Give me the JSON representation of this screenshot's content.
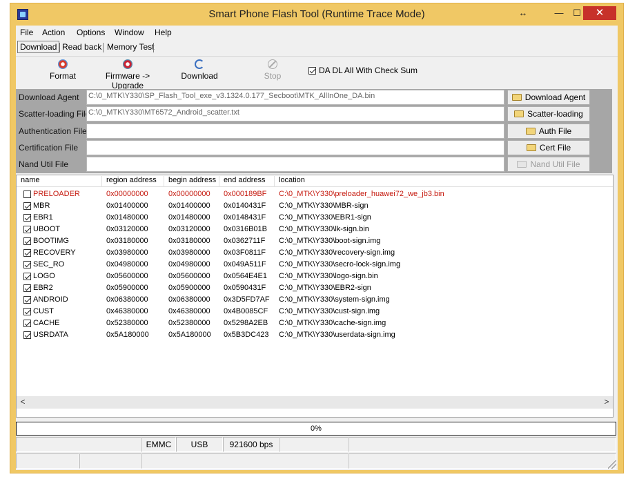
{
  "window": {
    "title": "Smart Phone Flash Tool (Runtime Trace Mode)",
    "resize_glyph": "↔",
    "min_glyph": "—",
    "max_glyph": "☐",
    "close_glyph": "✕"
  },
  "menu": [
    "File",
    "Action",
    "Options",
    "Window",
    "Help"
  ],
  "tabs": [
    "Download",
    "Read back",
    "Memory Test"
  ],
  "toolbar": {
    "format": "Format",
    "firmware_upgrade": "Firmware -> Upgrade",
    "download": "Download",
    "stop": "Stop",
    "checksum_label": "DA DL All With Check Sum",
    "checksum_checked": true
  },
  "files": [
    {
      "label": "Download Agent",
      "value": "C:\\0_MTK\\Y330\\SP_Flash_Tool_exe_v3.1324.0.177_Secboot\\MTK_AllInOne_DA.bin",
      "button": "Download Agent",
      "enabled": true
    },
    {
      "label": "Scatter-loading File",
      "value": "C:\\0_MTK\\Y330\\MT6572_Android_scatter.txt",
      "button": "Scatter-loading",
      "enabled": true
    },
    {
      "label": "Authentication File",
      "value": "",
      "button": "Auth File",
      "enabled": true
    },
    {
      "label": "Certification File",
      "value": "",
      "button": "Cert File",
      "enabled": true
    },
    {
      "label": "Nand Util File",
      "value": "",
      "button": "Nand Util File",
      "enabled": false
    }
  ],
  "list": {
    "columns": [
      "name",
      "region address",
      "begin address",
      "end address",
      "location"
    ],
    "rows": [
      {
        "checked": false,
        "name": "PRELOADER",
        "region": "0x00000000",
        "begin": "0x00000000",
        "end": "0x000189BF",
        "location": "C:\\0_MTK\\Y330\\preloader_huawei72_we_jb3.bin",
        "warn": true
      },
      {
        "checked": true,
        "name": "MBR",
        "region": "0x01400000",
        "begin": "0x01400000",
        "end": "0x0140431F",
        "location": "C:\\0_MTK\\Y330\\MBR-sign"
      },
      {
        "checked": true,
        "name": "EBR1",
        "region": "0x01480000",
        "begin": "0x01480000",
        "end": "0x0148431F",
        "location": "C:\\0_MTK\\Y330\\EBR1-sign"
      },
      {
        "checked": true,
        "name": "UBOOT",
        "region": "0x03120000",
        "begin": "0x03120000",
        "end": "0x0316B01B",
        "location": "C:\\0_MTK\\Y330\\lk-sign.bin"
      },
      {
        "checked": true,
        "name": "BOOTIMG",
        "region": "0x03180000",
        "begin": "0x03180000",
        "end": "0x0362711F",
        "location": "C:\\0_MTK\\Y330\\boot-sign.img"
      },
      {
        "checked": true,
        "name": "RECOVERY",
        "region": "0x03980000",
        "begin": "0x03980000",
        "end": "0x03F0811F",
        "location": "C:\\0_MTK\\Y330\\recovery-sign.img"
      },
      {
        "checked": true,
        "name": "SEC_RO",
        "region": "0x04980000",
        "begin": "0x04980000",
        "end": "0x049A511F",
        "location": "C:\\0_MTK\\Y330\\secro-lock-sign.img"
      },
      {
        "checked": true,
        "name": "LOGO",
        "region": "0x05600000",
        "begin": "0x05600000",
        "end": "0x0564E4E1",
        "location": "C:\\0_MTK\\Y330\\logo-sign.bin"
      },
      {
        "checked": true,
        "name": "EBR2",
        "region": "0x05900000",
        "begin": "0x05900000",
        "end": "0x0590431F",
        "location": "C:\\0_MTK\\Y330\\EBR2-sign"
      },
      {
        "checked": true,
        "name": "ANDROID",
        "region": "0x06380000",
        "begin": "0x06380000",
        "end": "0x3D5FD7AF",
        "location": "C:\\0_MTK\\Y330\\system-sign.img"
      },
      {
        "checked": true,
        "name": "CUST",
        "region": "0x46380000",
        "begin": "0x46380000",
        "end": "0x4B0085CF",
        "location": "C:\\0_MTK\\Y330\\cust-sign.img"
      },
      {
        "checked": true,
        "name": "CACHE",
        "region": "0x52380000",
        "begin": "0x52380000",
        "end": "0x5298A2EB",
        "location": "C:\\0_MTK\\Y330\\cache-sign.img"
      },
      {
        "checked": true,
        "name": "USRDATA",
        "region": "0x5A180000",
        "begin": "0x5A180000",
        "end": "0x5B3DC423",
        "location": "C:\\0_MTK\\Y330\\userdata-sign.img"
      }
    ]
  },
  "scroll": {
    "left": "<",
    "right": ">"
  },
  "progress": {
    "value": 0,
    "label": "0%"
  },
  "status": {
    "storage": "EMMC",
    "interface": "USB",
    "baud": "921600 bps"
  },
  "colors": {
    "title_bg": "#f0c865",
    "close_red": "#c7312a",
    "warn_red": "#c61b10",
    "file_panel": "#a6a6a6"
  }
}
